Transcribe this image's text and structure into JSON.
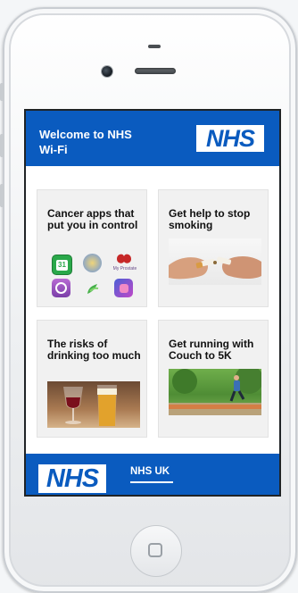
{
  "header": {
    "welcome_text": "Welcome to NHS Wi-Fi",
    "logo_text": "NHS"
  },
  "cards": [
    {
      "title": "Cancer apps that put you in control",
      "image": "app-icons-grid"
    },
    {
      "title": "Get help to stop smoking",
      "image": "breaking-cigarette"
    },
    {
      "title": "The risks of drinking too much",
      "image": "wine-and-beer-glasses"
    },
    {
      "title": "Get running with Couch to 5K",
      "image": "woman-running-in-park"
    }
  ],
  "app_icons": {
    "calendar_day": "31",
    "small_label": "My Prostate"
  },
  "footer": {
    "logo_text": "NHS",
    "link_label": "NHS UK"
  },
  "colors": {
    "nhs_blue": "#0a5bbf"
  }
}
